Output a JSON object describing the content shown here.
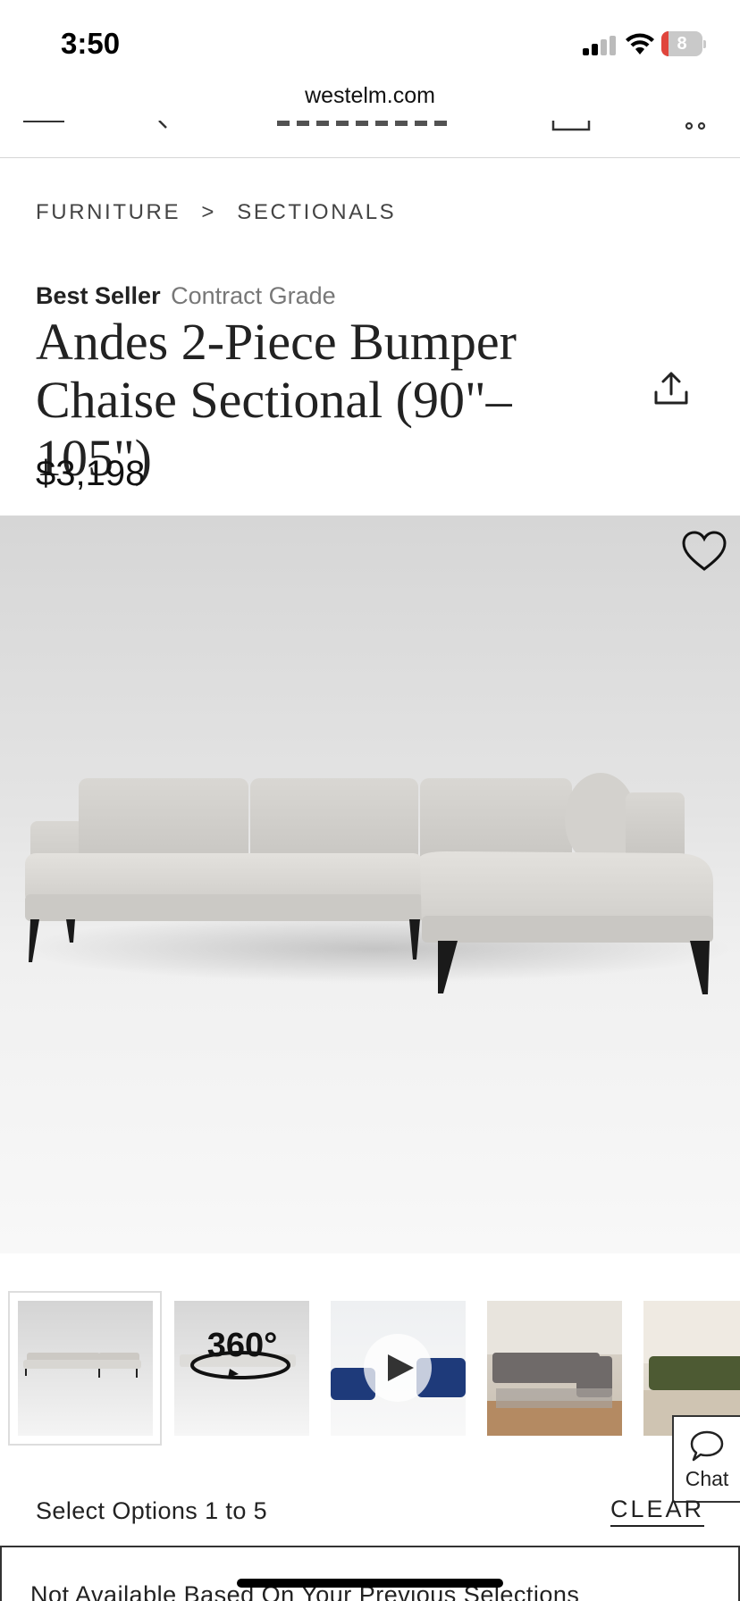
{
  "status_bar": {
    "time": "3:50",
    "battery_level": "8",
    "battery_color": "#e0453c"
  },
  "browser": {
    "url": "westelm.com"
  },
  "breadcrumb": {
    "items": [
      "FURNITURE",
      "SECTIONALS"
    ],
    "separator": ">"
  },
  "product": {
    "badge_primary": "Best Seller",
    "badge_secondary": "Contract Grade",
    "title": "Andes 2-Piece Bumper Chaise Sectional (90\"–105\")",
    "price": "$3,198"
  },
  "icons": {
    "share": "share-icon",
    "favorite": "heart-icon",
    "chat": "chat-bubble-icon",
    "play": "play-icon"
  },
  "gallery": {
    "thumb_360_label": "360°"
  },
  "chat": {
    "label": "Chat"
  },
  "options": {
    "label": "Select Options 1 to 5",
    "clear_label": "CLEAR"
  },
  "notice": {
    "text": "Not Available Based On Your Previous Selections"
  }
}
